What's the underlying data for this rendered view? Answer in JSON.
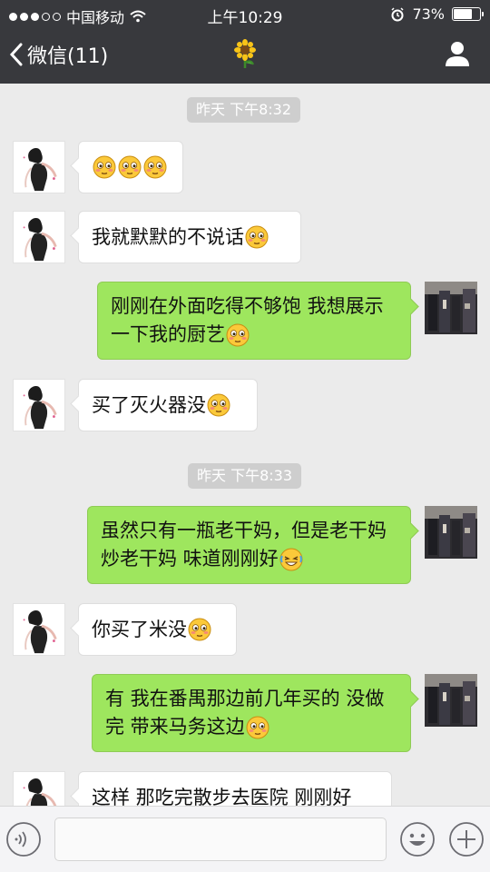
{
  "status_bar": {
    "carrier": "中国移动",
    "time": "上午10:29",
    "battery": "73%",
    "battery_level": 0.73
  },
  "nav": {
    "back_label": "微信(11)",
    "title_icon": "sunflower-icon",
    "profile_icon": "person-icon"
  },
  "messages": {
    "t1": "昨天 下午8:32",
    "m1_emoji": [
      "blush-emoji",
      "blush-emoji",
      "blush-emoji"
    ],
    "m2": "我就默默的不说话",
    "m3": "刚刚在外面吃得不够饱  我想展示一下我的厨艺",
    "m4": "买了灭火器没",
    "t2": "昨天 下午8:33",
    "m5": "虽然只有一瓶老干妈，但是老干妈炒老干妈 味道刚刚好",
    "m6": "你买了米没",
    "m7": "有  我在番禺那边前几年买的 没做完  带来马务这边",
    "m8": "这样 那吃完散步去医院 刚刚好"
  },
  "input": {
    "placeholder": "",
    "value": ""
  },
  "colors": {
    "header_bg": "#38393d",
    "chat_bg": "#ebebeb",
    "bubble_right": "#9ee65e",
    "bubble_left": "#ffffff",
    "time_badge": "#cecece"
  }
}
